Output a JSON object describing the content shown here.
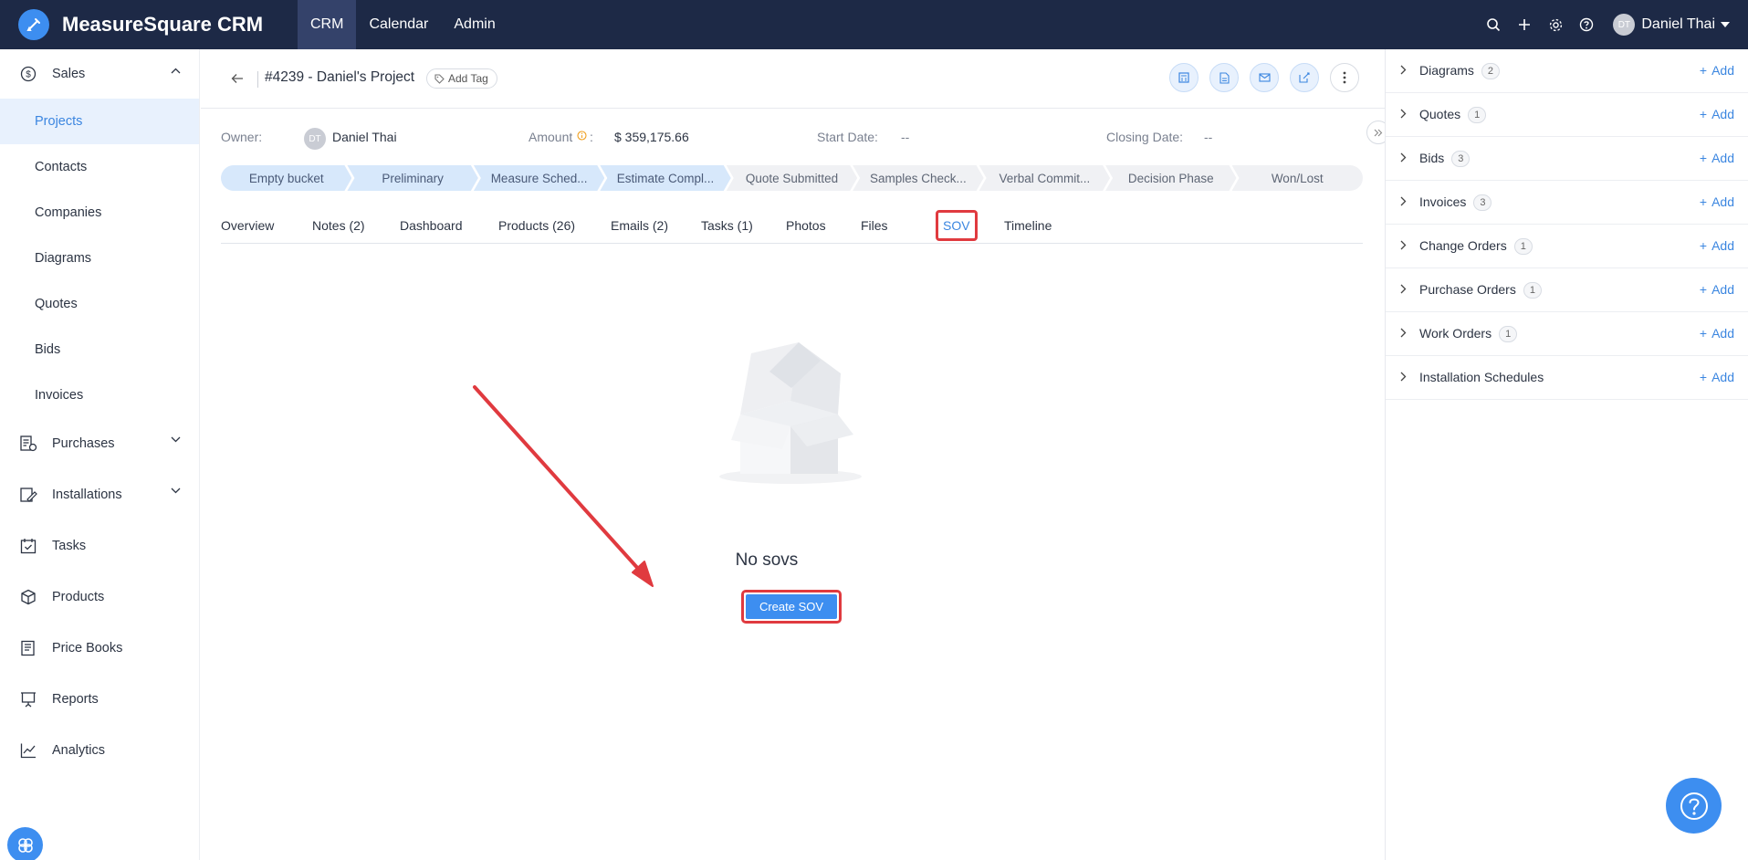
{
  "app": {
    "name": "MeasureSquare CRM"
  },
  "topnav": {
    "items": [
      "CRM",
      "Calendar",
      "Admin"
    ],
    "active": "CRM"
  },
  "user": {
    "initials": "DT",
    "name": "Daniel Thai"
  },
  "sidebar": {
    "sales": "Sales",
    "sales_items": [
      "Projects",
      "Contacts",
      "Companies",
      "Diagrams",
      "Quotes",
      "Bids",
      "Invoices"
    ],
    "purchases": "Purchases",
    "installations": "Installations",
    "tasks": "Tasks",
    "products": "Products",
    "price_books": "Price Books",
    "reports": "Reports",
    "analytics": "Analytics"
  },
  "project": {
    "title": "#4239 - Daniel's Project",
    "add_tag": "Add Tag",
    "owner_label": "Owner:",
    "owner_initials": "DT",
    "owner_name": "Daniel Thai",
    "amount_label": "Amount",
    "amount_colon": ":",
    "amount_value": "$ 359,175.66",
    "start_label": "Start Date:",
    "start_value": "--",
    "closing_label": "Closing Date:",
    "closing_value": "--"
  },
  "stages": [
    "Empty bucket",
    "Preliminary",
    "Measure Sched...",
    "Estimate Compl...",
    "Quote Submitted",
    "Samples Check...",
    "Verbal Commit...",
    "Decision Phase",
    "Won/Lost"
  ],
  "stages_done_count": 4,
  "tabs": [
    "Overview",
    "Notes (2)",
    "Dashboard",
    "Products (26)",
    "Emails (2)",
    "Tasks (1)",
    "Photos",
    "Files",
    "SOV",
    "Timeline"
  ],
  "active_tab": "SOV",
  "empty": {
    "text": "No sovs",
    "button": "Create SOV"
  },
  "rpanel": {
    "rows": [
      {
        "label": "Diagrams",
        "count": "2"
      },
      {
        "label": "Quotes",
        "count": "1"
      },
      {
        "label": "Bids",
        "count": "3"
      },
      {
        "label": "Invoices",
        "count": "3"
      },
      {
        "label": "Change Orders",
        "count": "1"
      },
      {
        "label": "Purchase Orders",
        "count": "1"
      },
      {
        "label": "Work Orders",
        "count": "1"
      },
      {
        "label": "Installation Schedules",
        "count": ""
      }
    ],
    "add_label": "Add"
  },
  "colors": {
    "topbar": "#1d2946",
    "accent": "#3d8ef0",
    "highlight": "#e03a3f",
    "active_bg": "#e8f1fd"
  }
}
